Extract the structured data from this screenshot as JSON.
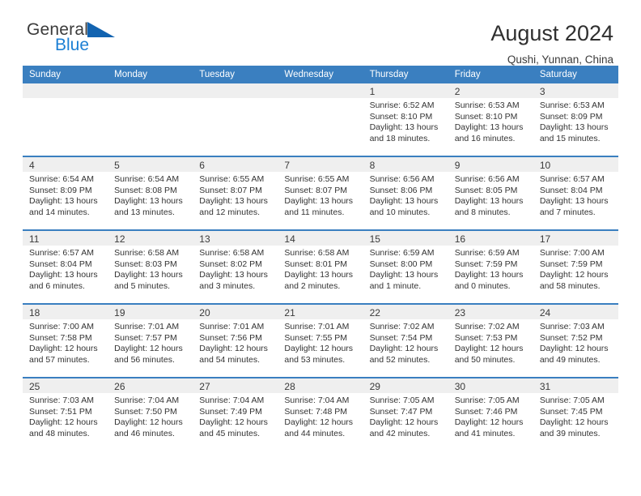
{
  "brand": {
    "name_top": "General",
    "name_bottom": "Blue"
  },
  "header": {
    "title": "August 2024",
    "location": "Qushi, Yunnan, China"
  },
  "calendar": {
    "weekday_headers": [
      "Sunday",
      "Monday",
      "Tuesday",
      "Wednesday",
      "Thursday",
      "Friday",
      "Saturday"
    ],
    "labels": {
      "sunrise": "Sunrise:",
      "sunset": "Sunset:",
      "daylight": "Daylight:"
    },
    "accent_color": "#3a7fc0",
    "daynum_band_color": "#efefef",
    "weeks": [
      [
        {
          "day": "",
          "empty": true
        },
        {
          "day": "",
          "empty": true
        },
        {
          "day": "",
          "empty": true
        },
        {
          "day": "",
          "empty": true
        },
        {
          "day": "1",
          "sunrise": "Sunrise: 6:52 AM",
          "sunset": "Sunset: 8:10 PM",
          "daylight_1": "Daylight: 13 hours",
          "daylight_2": "and 18 minutes."
        },
        {
          "day": "2",
          "sunrise": "Sunrise: 6:53 AM",
          "sunset": "Sunset: 8:10 PM",
          "daylight_1": "Daylight: 13 hours",
          "daylight_2": "and 16 minutes."
        },
        {
          "day": "3",
          "sunrise": "Sunrise: 6:53 AM",
          "sunset": "Sunset: 8:09 PM",
          "daylight_1": "Daylight: 13 hours",
          "daylight_2": "and 15 minutes."
        }
      ],
      [
        {
          "day": "4",
          "sunrise": "Sunrise: 6:54 AM",
          "sunset": "Sunset: 8:09 PM",
          "daylight_1": "Daylight: 13 hours",
          "daylight_2": "and 14 minutes."
        },
        {
          "day": "5",
          "sunrise": "Sunrise: 6:54 AM",
          "sunset": "Sunset: 8:08 PM",
          "daylight_1": "Daylight: 13 hours",
          "daylight_2": "and 13 minutes."
        },
        {
          "day": "6",
          "sunrise": "Sunrise: 6:55 AM",
          "sunset": "Sunset: 8:07 PM",
          "daylight_1": "Daylight: 13 hours",
          "daylight_2": "and 12 minutes."
        },
        {
          "day": "7",
          "sunrise": "Sunrise: 6:55 AM",
          "sunset": "Sunset: 8:07 PM",
          "daylight_1": "Daylight: 13 hours",
          "daylight_2": "and 11 minutes."
        },
        {
          "day": "8",
          "sunrise": "Sunrise: 6:56 AM",
          "sunset": "Sunset: 8:06 PM",
          "daylight_1": "Daylight: 13 hours",
          "daylight_2": "and 10 minutes."
        },
        {
          "day": "9",
          "sunrise": "Sunrise: 6:56 AM",
          "sunset": "Sunset: 8:05 PM",
          "daylight_1": "Daylight: 13 hours",
          "daylight_2": "and 8 minutes."
        },
        {
          "day": "10",
          "sunrise": "Sunrise: 6:57 AM",
          "sunset": "Sunset: 8:04 PM",
          "daylight_1": "Daylight: 13 hours",
          "daylight_2": "and 7 minutes."
        }
      ],
      [
        {
          "day": "11",
          "sunrise": "Sunrise: 6:57 AM",
          "sunset": "Sunset: 8:04 PM",
          "daylight_1": "Daylight: 13 hours",
          "daylight_2": "and 6 minutes."
        },
        {
          "day": "12",
          "sunrise": "Sunrise: 6:58 AM",
          "sunset": "Sunset: 8:03 PM",
          "daylight_1": "Daylight: 13 hours",
          "daylight_2": "and 5 minutes."
        },
        {
          "day": "13",
          "sunrise": "Sunrise: 6:58 AM",
          "sunset": "Sunset: 8:02 PM",
          "daylight_1": "Daylight: 13 hours",
          "daylight_2": "and 3 minutes."
        },
        {
          "day": "14",
          "sunrise": "Sunrise: 6:58 AM",
          "sunset": "Sunset: 8:01 PM",
          "daylight_1": "Daylight: 13 hours",
          "daylight_2": "and 2 minutes."
        },
        {
          "day": "15",
          "sunrise": "Sunrise: 6:59 AM",
          "sunset": "Sunset: 8:00 PM",
          "daylight_1": "Daylight: 13 hours",
          "daylight_2": "and 1 minute."
        },
        {
          "day": "16",
          "sunrise": "Sunrise: 6:59 AM",
          "sunset": "Sunset: 7:59 PM",
          "daylight_1": "Daylight: 13 hours",
          "daylight_2": "and 0 minutes."
        },
        {
          "day": "17",
          "sunrise": "Sunrise: 7:00 AM",
          "sunset": "Sunset: 7:59 PM",
          "daylight_1": "Daylight: 12 hours",
          "daylight_2": "and 58 minutes."
        }
      ],
      [
        {
          "day": "18",
          "sunrise": "Sunrise: 7:00 AM",
          "sunset": "Sunset: 7:58 PM",
          "daylight_1": "Daylight: 12 hours",
          "daylight_2": "and 57 minutes."
        },
        {
          "day": "19",
          "sunrise": "Sunrise: 7:01 AM",
          "sunset": "Sunset: 7:57 PM",
          "daylight_1": "Daylight: 12 hours",
          "daylight_2": "and 56 minutes."
        },
        {
          "day": "20",
          "sunrise": "Sunrise: 7:01 AM",
          "sunset": "Sunset: 7:56 PM",
          "daylight_1": "Daylight: 12 hours",
          "daylight_2": "and 54 minutes."
        },
        {
          "day": "21",
          "sunrise": "Sunrise: 7:01 AM",
          "sunset": "Sunset: 7:55 PM",
          "daylight_1": "Daylight: 12 hours",
          "daylight_2": "and 53 minutes."
        },
        {
          "day": "22",
          "sunrise": "Sunrise: 7:02 AM",
          "sunset": "Sunset: 7:54 PM",
          "daylight_1": "Daylight: 12 hours",
          "daylight_2": "and 52 minutes."
        },
        {
          "day": "23",
          "sunrise": "Sunrise: 7:02 AM",
          "sunset": "Sunset: 7:53 PM",
          "daylight_1": "Daylight: 12 hours",
          "daylight_2": "and 50 minutes."
        },
        {
          "day": "24",
          "sunrise": "Sunrise: 7:03 AM",
          "sunset": "Sunset: 7:52 PM",
          "daylight_1": "Daylight: 12 hours",
          "daylight_2": "and 49 minutes."
        }
      ],
      [
        {
          "day": "25",
          "sunrise": "Sunrise: 7:03 AM",
          "sunset": "Sunset: 7:51 PM",
          "daylight_1": "Daylight: 12 hours",
          "daylight_2": "and 48 minutes."
        },
        {
          "day": "26",
          "sunrise": "Sunrise: 7:04 AM",
          "sunset": "Sunset: 7:50 PM",
          "daylight_1": "Daylight: 12 hours",
          "daylight_2": "and 46 minutes."
        },
        {
          "day": "27",
          "sunrise": "Sunrise: 7:04 AM",
          "sunset": "Sunset: 7:49 PM",
          "daylight_1": "Daylight: 12 hours",
          "daylight_2": "and 45 minutes."
        },
        {
          "day": "28",
          "sunrise": "Sunrise: 7:04 AM",
          "sunset": "Sunset: 7:48 PM",
          "daylight_1": "Daylight: 12 hours",
          "daylight_2": "and 44 minutes."
        },
        {
          "day": "29",
          "sunrise": "Sunrise: 7:05 AM",
          "sunset": "Sunset: 7:47 PM",
          "daylight_1": "Daylight: 12 hours",
          "daylight_2": "and 42 minutes."
        },
        {
          "day": "30",
          "sunrise": "Sunrise: 7:05 AM",
          "sunset": "Sunset: 7:46 PM",
          "daylight_1": "Daylight: 12 hours",
          "daylight_2": "and 41 minutes."
        },
        {
          "day": "31",
          "sunrise": "Sunrise: 7:05 AM",
          "sunset": "Sunset: 7:45 PM",
          "daylight_1": "Daylight: 12 hours",
          "daylight_2": "and 39 minutes."
        }
      ]
    ]
  }
}
